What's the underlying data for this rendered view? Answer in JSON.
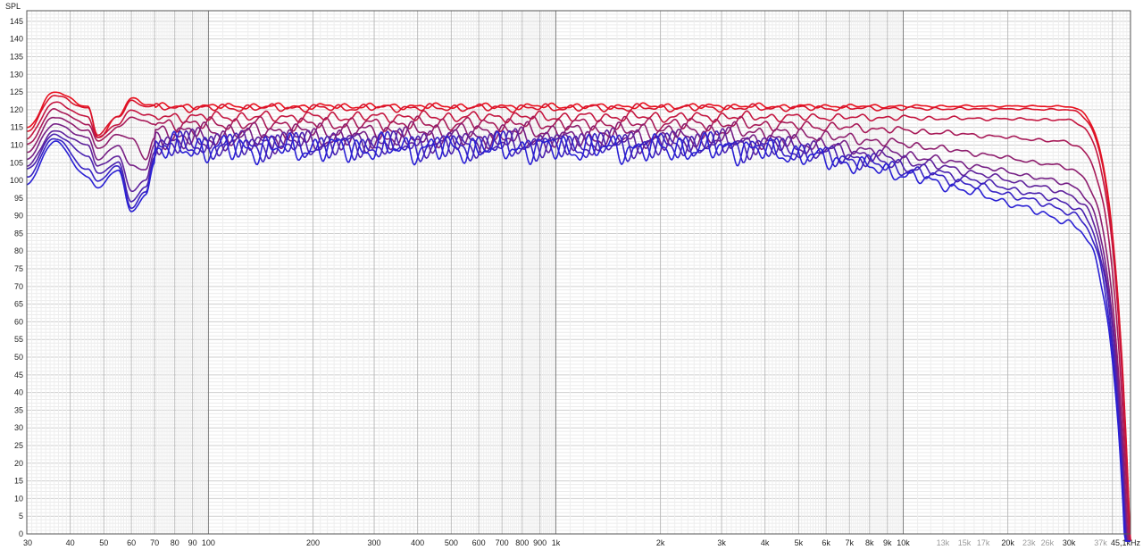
{
  "chart_data": {
    "type": "line",
    "title": "",
    "ylabel": "SPL",
    "xlabel": "",
    "x_scale": "log",
    "xlim_hz": [
      30,
      45100
    ],
    "ylim": [
      0,
      148
    ],
    "grid": true,
    "y_ticks": [
      "145",
      "140",
      "135",
      "130",
      "125",
      "120",
      "115",
      "110",
      "105",
      "100",
      "95",
      "90",
      "85",
      "80",
      "75",
      "70",
      "65",
      "60",
      "55",
      "50",
      "45",
      "40",
      "35",
      "30",
      "25",
      "20",
      "15",
      "10",
      "5",
      "0"
    ],
    "x_tick_labels": [
      {
        "label": "30",
        "hz": 30
      },
      {
        "label": "40",
        "hz": 40
      },
      {
        "label": "50",
        "hz": 50
      },
      {
        "label": "60",
        "hz": 60
      },
      {
        "label": "70",
        "hz": 70
      },
      {
        "label": "80",
        "hz": 80
      },
      {
        "label": "90",
        "hz": 90
      },
      {
        "label": "100",
        "hz": 100
      },
      {
        "label": "200",
        "hz": 200
      },
      {
        "label": "300",
        "hz": 300
      },
      {
        "label": "400",
        "hz": 400
      },
      {
        "label": "500",
        "hz": 500
      },
      {
        "label": "600",
        "hz": 600
      },
      {
        "label": "700",
        "hz": 700
      },
      {
        "label": "800",
        "hz": 800
      },
      {
        "label": "900",
        "hz": 900
      },
      {
        "label": "1k",
        "hz": 1000
      },
      {
        "label": "2k",
        "hz": 2000
      },
      {
        "label": "3k",
        "hz": 3000
      },
      {
        "label": "4k",
        "hz": 4000
      },
      {
        "label": "5k",
        "hz": 5000
      },
      {
        "label": "6k",
        "hz": 6000
      },
      {
        "label": "7k",
        "hz": 7000
      },
      {
        "label": "8k",
        "hz": 8000
      },
      {
        "label": "9k",
        "hz": 9000
      },
      {
        "label": "10k",
        "hz": 10000
      },
      {
        "label": "13k",
        "hz": 13000,
        "faint": true
      },
      {
        "label": "15k",
        "hz": 15000,
        "faint": true
      },
      {
        "label": "17k",
        "hz": 17000,
        "faint": true
      },
      {
        "label": "20k",
        "hz": 20000
      },
      {
        "label": "23k",
        "hz": 23000,
        "faint": true
      },
      {
        "label": "26k",
        "hz": 26000,
        "faint": true
      },
      {
        "label": "30k",
        "hz": 30000
      },
      {
        "label": "37k",
        "hz": 37000,
        "faint": true
      },
      {
        "label": "45,1kHz",
        "hz": 45100
      }
    ],
    "series": [
      {
        "color": "#e8101e",
        "level_db": 121.0,
        "hf_droop_db": 0.0,
        "ripple_db": 1.0,
        "low": [
          [
            30,
            115
          ],
          [
            36,
            125
          ],
          [
            45,
            121
          ],
          [
            48,
            112
          ],
          [
            55,
            118
          ],
          [
            60,
            123.5
          ],
          [
            66,
            121.5
          ],
          [
            70,
            121.5
          ]
        ]
      },
      {
        "color": "#d8132b",
        "level_db": 120.5,
        "hf_droop_db": 0.5,
        "ripple_db": 1.3,
        "low": [
          [
            30,
            114
          ],
          [
            36,
            124
          ],
          [
            45,
            120.5
          ],
          [
            48,
            113
          ],
          [
            55,
            118
          ],
          [
            60,
            122.5
          ],
          [
            66,
            121
          ],
          [
            70,
            121
          ]
        ]
      },
      {
        "color": "#c41640",
        "level_db": 118.0,
        "hf_droop_db": 1.0,
        "ripple_db": 1.8,
        "low": [
          [
            30,
            112
          ],
          [
            36,
            122
          ],
          [
            45,
            118
          ],
          [
            48,
            112
          ],
          [
            55,
            116
          ],
          [
            60,
            120
          ],
          [
            66,
            118.5
          ],
          [
            70,
            118
          ]
        ]
      },
      {
        "color": "#a81a58",
        "level_db": 116.0,
        "hf_droop_db": 6.0,
        "ripple_db": 2.3,
        "low": [
          [
            30,
            110
          ],
          [
            36,
            120
          ],
          [
            45,
            116
          ],
          [
            48,
            111
          ],
          [
            55,
            115
          ],
          [
            60,
            118
          ],
          [
            66,
            116.5
          ],
          [
            70,
            116
          ]
        ]
      },
      {
        "color": "#8e1e6e",
        "level_db": 114.0,
        "hf_droop_db": 12.0,
        "ripple_db": 2.8,
        "low": [
          [
            30,
            108
          ],
          [
            36,
            118
          ],
          [
            45,
            114
          ],
          [
            48,
            109
          ],
          [
            55,
            113
          ],
          [
            60,
            112
          ],
          [
            66,
            106
          ],
          [
            70,
            112
          ]
        ]
      },
      {
        "color": "#762086",
        "level_db": 112.0,
        "hf_droop_db": 15.0,
        "ripple_db": 3.3,
        "low": [
          [
            30,
            106
          ],
          [
            36,
            116
          ],
          [
            45,
            112
          ],
          [
            48,
            106
          ],
          [
            55,
            110
          ],
          [
            60,
            104
          ],
          [
            66,
            103
          ],
          [
            70,
            110
          ]
        ]
      },
      {
        "color": "#5f229c",
        "level_db": 111.0,
        "hf_droop_db": 17.0,
        "ripple_db": 3.8,
        "low": [
          [
            30,
            104
          ],
          [
            36,
            114
          ],
          [
            45,
            110
          ],
          [
            48,
            104
          ],
          [
            55,
            107
          ],
          [
            60,
            97
          ],
          [
            66,
            100
          ],
          [
            70,
            108
          ]
        ]
      },
      {
        "color": "#4a22b0",
        "level_db": 110.0,
        "hf_droop_db": 19.0,
        "ripple_db": 4.2,
        "low": [
          [
            30,
            103
          ],
          [
            36,
            113
          ],
          [
            45,
            107
          ],
          [
            48,
            102
          ],
          [
            55,
            105
          ],
          [
            60,
            94
          ],
          [
            66,
            98
          ],
          [
            70,
            107
          ]
        ]
      },
      {
        "color": "#3621c4",
        "level_db": 109.5,
        "hf_droop_db": 21.0,
        "ripple_db": 4.6,
        "low": [
          [
            30,
            101
          ],
          [
            36,
            112
          ],
          [
            45,
            103
          ],
          [
            48,
            100
          ],
          [
            55,
            104
          ],
          [
            60,
            92
          ],
          [
            66,
            97
          ],
          [
            70,
            106
          ]
        ]
      },
      {
        "color": "#2a20d4",
        "level_db": 109.0,
        "hf_droop_db": 24.0,
        "ripple_db": 5.0,
        "low": [
          [
            30,
            99
          ],
          [
            36,
            111
          ],
          [
            45,
            101
          ],
          [
            48,
            98
          ],
          [
            55,
            103
          ],
          [
            60,
            91
          ],
          [
            66,
            96
          ],
          [
            70,
            105
          ]
        ]
      }
    ]
  }
}
